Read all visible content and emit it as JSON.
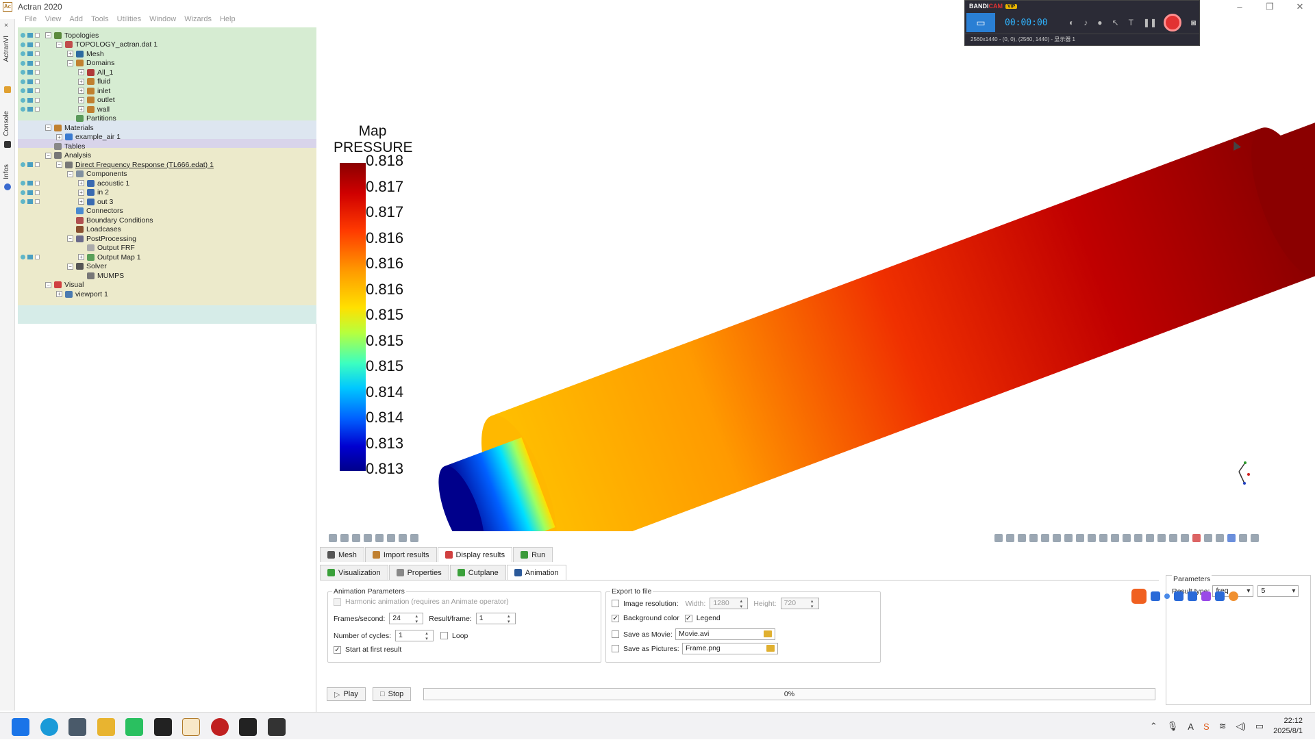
{
  "window": {
    "title": "Actran 2020"
  },
  "menu": [
    "File",
    "View",
    "Add",
    "Tools",
    "Utilities",
    "Window",
    "Wizards",
    "Help"
  ],
  "side_tabs": [
    "ActranVI",
    "Console",
    "Infos"
  ],
  "tree": [
    {
      "label": "Topologies",
      "indent": 0,
      "exp": "−",
      "color": "#5a8a3c",
      "vis": true
    },
    {
      "label": "TOPOLOGY_actran.dat 1",
      "indent": 1,
      "exp": "−",
      "color": "#c04c4c",
      "vis": true
    },
    {
      "label": "Mesh",
      "indent": 2,
      "exp": "+",
      "color": "#2c6aa0",
      "vis": true
    },
    {
      "label": "Domains",
      "indent": 2,
      "exp": "−",
      "color": "#c08030",
      "vis": true
    },
    {
      "label": "All_1",
      "indent": 3,
      "exp": "+",
      "color": "#b03a3a",
      "vis": true
    },
    {
      "label": "fluid",
      "indent": 3,
      "exp": "+",
      "color": "#c08030",
      "vis": true
    },
    {
      "label": "inlet",
      "indent": 3,
      "exp": "+",
      "color": "#c08030",
      "vis": true
    },
    {
      "label": "outlet",
      "indent": 3,
      "exp": "+",
      "color": "#c08030",
      "vis": true
    },
    {
      "label": "wall",
      "indent": 3,
      "exp": "+",
      "color": "#c08030",
      "vis": true
    },
    {
      "label": "Partitions",
      "indent": 2,
      "exp": "",
      "color": "#5a9a5a",
      "vis": false
    },
    {
      "label": "Materials",
      "indent": 0,
      "exp": "−",
      "color": "#c08030",
      "vis": false
    },
    {
      "label": "example_air 1",
      "indent": 1,
      "exp": "+",
      "color": "#3a7ad0",
      "vis": false
    },
    {
      "label": "Tables",
      "indent": 0,
      "exp": "",
      "color": "#888888",
      "vis": false
    },
    {
      "label": "Analysis",
      "indent": 0,
      "exp": "−",
      "color": "#777777",
      "vis": false
    },
    {
      "label": "Direct Frequency Response (TL666.edat) 1",
      "indent": 1,
      "exp": "−",
      "color": "#777777",
      "vis": true,
      "underline": true
    },
    {
      "label": "Components",
      "indent": 2,
      "exp": "−",
      "color": "#8090a0",
      "vis": false
    },
    {
      "label": "acoustic 1",
      "indent": 3,
      "exp": "+",
      "color": "#3a6ab0",
      "vis": true
    },
    {
      "label": "in 2",
      "indent": 3,
      "exp": "+",
      "color": "#3a6ab0",
      "vis": true
    },
    {
      "label": "out 3",
      "indent": 3,
      "exp": "+",
      "color": "#3a6ab0",
      "vis": true
    },
    {
      "label": "Connectors",
      "indent": 2,
      "exp": "",
      "color": "#4a8ad0",
      "vis": false
    },
    {
      "label": "Boundary Conditions",
      "indent": 2,
      "exp": "",
      "color": "#b05050",
      "vis": false
    },
    {
      "label": "Loadcases",
      "indent": 2,
      "exp": "",
      "color": "#8a5030",
      "vis": false
    },
    {
      "label": "PostProcessing",
      "indent": 2,
      "exp": "−",
      "color": "#6a6a8a",
      "vis": false
    },
    {
      "label": "Output FRF",
      "indent": 3,
      "exp": "",
      "color": "#aaaaaa",
      "vis": false
    },
    {
      "label": "Output Map 1",
      "indent": 3,
      "exp": "+",
      "color": "#5aa05a",
      "vis": true
    },
    {
      "label": "Solver",
      "indent": 2,
      "exp": "−",
      "color": "#555555",
      "vis": false
    },
    {
      "label": "MUMPS",
      "indent": 3,
      "exp": "",
      "color": "#777777",
      "vis": false
    },
    {
      "label": "Visual",
      "indent": 0,
      "exp": "−",
      "color": "#d04040",
      "vis": false
    },
    {
      "label": "viewport 1",
      "indent": 1,
      "exp": "+",
      "color": "#4a7ab0",
      "vis": false
    }
  ],
  "legend": {
    "title_line1": "Map",
    "title_line2": "PRESSURE",
    "ticks": [
      "0.818",
      "0.817",
      "0.817",
      "0.816",
      "0.816",
      "0.816",
      "0.815",
      "0.815",
      "0.815",
      "0.814",
      "0.814",
      "0.813",
      "0.813"
    ]
  },
  "bandicam": {
    "brand_a": "BANDI",
    "brand_b": "CAM",
    "vip": "VIP",
    "timer": "00:00:00",
    "info": "2560x1440 - (0, 0), (2560, 1440) - 显示器 1"
  },
  "main_tabs": [
    {
      "label": "Mesh",
      "active": false,
      "color": "#555555"
    },
    {
      "label": "Import results",
      "active": false,
      "color": "#c08030"
    },
    {
      "label": "Display results",
      "active": true,
      "color": "#d04040"
    },
    {
      "label": "Run",
      "active": false,
      "color": "#3a9a3a"
    }
  ],
  "sub_tabs": [
    {
      "label": "Visualization",
      "active": false,
      "color": "#3aa03a"
    },
    {
      "label": "Properties",
      "active": false,
      "color": "#888888"
    },
    {
      "label": "Cutplane",
      "active": false,
      "color": "#3aa03a"
    },
    {
      "label": "Animation",
      "active": true,
      "color": "#2c5a9a"
    }
  ],
  "animation": {
    "group_title": "Animation Parameters",
    "harmonic_label": "Harmonic animation (requires an Animate operator)",
    "fps_label": "Frames/second:",
    "fps_value": "24",
    "rpf_label": "Result/frame:",
    "rpf_value": "1",
    "cycles_label": "Number of cycles:",
    "cycles_value": "1",
    "loop_label": "Loop",
    "start_label": "Start at first result",
    "start_checked": "✓"
  },
  "export": {
    "group_title": "Export to file",
    "resolution_label": "Image resolution:",
    "width_label": "Width:",
    "width_value": "1280",
    "height_label": "Height:",
    "height_value": "720",
    "bg_label": "Background color",
    "bg_checked": "✓",
    "legend_label": "Legend",
    "legend_checked": "✓",
    "movie_label": "Save as Movie:",
    "movie_value": "Movie.avi",
    "pictures_label": "Save as Pictures:",
    "pictures_value": "Frame.png"
  },
  "controls": {
    "play_label": "Play",
    "stop_label": "Stop",
    "progress_text": "0%",
    "progress_value": 0
  },
  "parameters": {
    "title": "Parameters",
    "result_type_label": "Result type:",
    "result_type_value": "freq",
    "index_value": "5"
  },
  "clock": {
    "time": "22:12",
    "date": "2025/8/1"
  }
}
